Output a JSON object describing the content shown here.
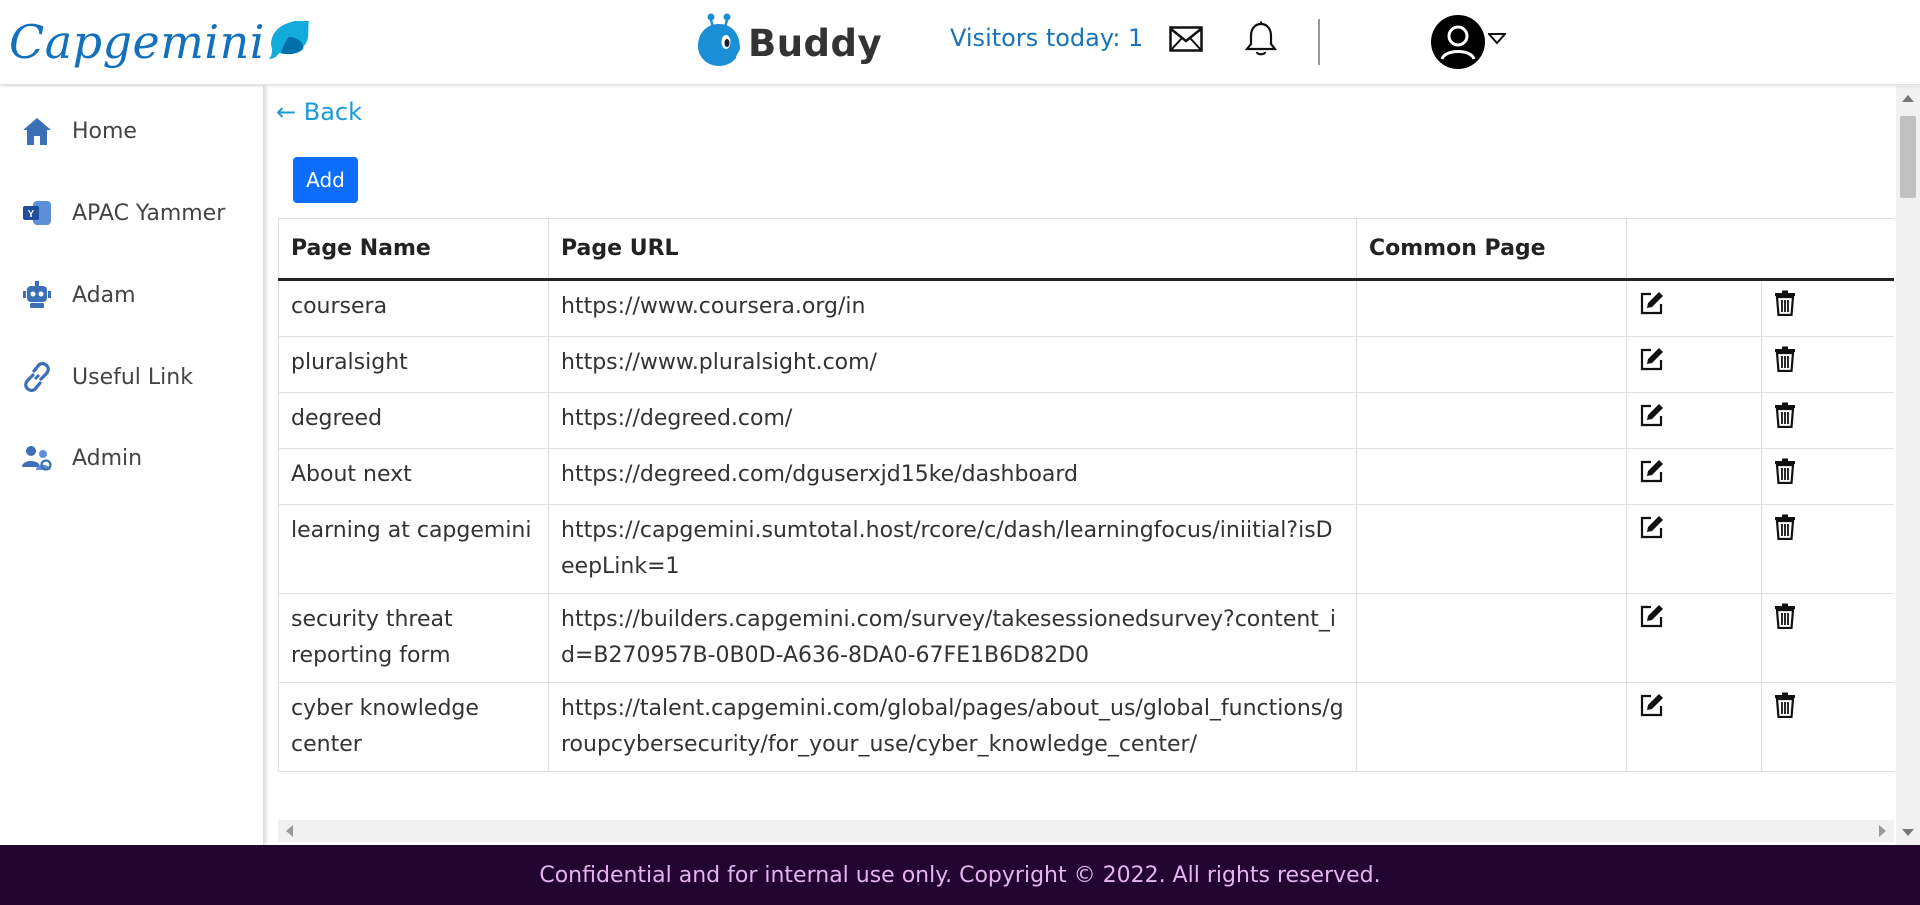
{
  "header": {
    "brand": "Capgemini",
    "app_name": "Buddy",
    "visitors_text": "Visitors today: 1",
    "icons": [
      "mail-icon",
      "bell-icon",
      "user-avatar-icon",
      "caret-down-icon"
    ]
  },
  "sidebar": {
    "items": [
      {
        "label": "Home",
        "icon": "home-icon"
      },
      {
        "label": "APAC Yammer",
        "icon": "yammer-icon"
      },
      {
        "label": "Adam",
        "icon": "robot-icon"
      },
      {
        "label": "Useful Link",
        "icon": "link-icon"
      },
      {
        "label": "Admin",
        "icon": "admin-users-icon"
      }
    ]
  },
  "main": {
    "back_label": "← Back",
    "add_label": "Add",
    "table": {
      "columns": [
        "Page Name",
        "Page URL",
        "Common Page",
        "",
        ""
      ],
      "rows": [
        {
          "name": "coursera",
          "url": "https://www.coursera.org/in",
          "common": ""
        },
        {
          "name": "pluralsight",
          "url": "https://www.pluralsight.com/",
          "common": ""
        },
        {
          "name": "degreed",
          "url": "https://degreed.com/",
          "common": ""
        },
        {
          "name": "About next",
          "url": "https://degreed.com/dguserxjd15ke/dashboard",
          "common": ""
        },
        {
          "name": "learning at capgemini",
          "url": "https://capgemini.sumtotal.host/rcore/c/dash/learningfocus/iniitial?isDeepLink=1",
          "common": ""
        },
        {
          "name": "security threat reporting form",
          "url": "https://builders.capgemini.com/survey/takesessionedsurvey?content_id=B270957B-0B0D-A636-8DA0-67FE1B6D82D0",
          "common": ""
        },
        {
          "name": "cyber knowledge center",
          "url": "https://talent.capgemini.com/global/pages/about_us/global_functions/groupcybersecurity/for_your_use/cyber_knowledge_center/",
          "common": ""
        }
      ]
    }
  },
  "footer": {
    "text": "Confidential and for internal use only. Copyright © 2022. All rights reserved."
  },
  "colors": {
    "brand_blue": "#1370bd",
    "link_blue": "#1a9bd7",
    "button_blue": "#0d6efd",
    "footer_bg": "#23032f",
    "footer_text": "#e6b3f2"
  }
}
